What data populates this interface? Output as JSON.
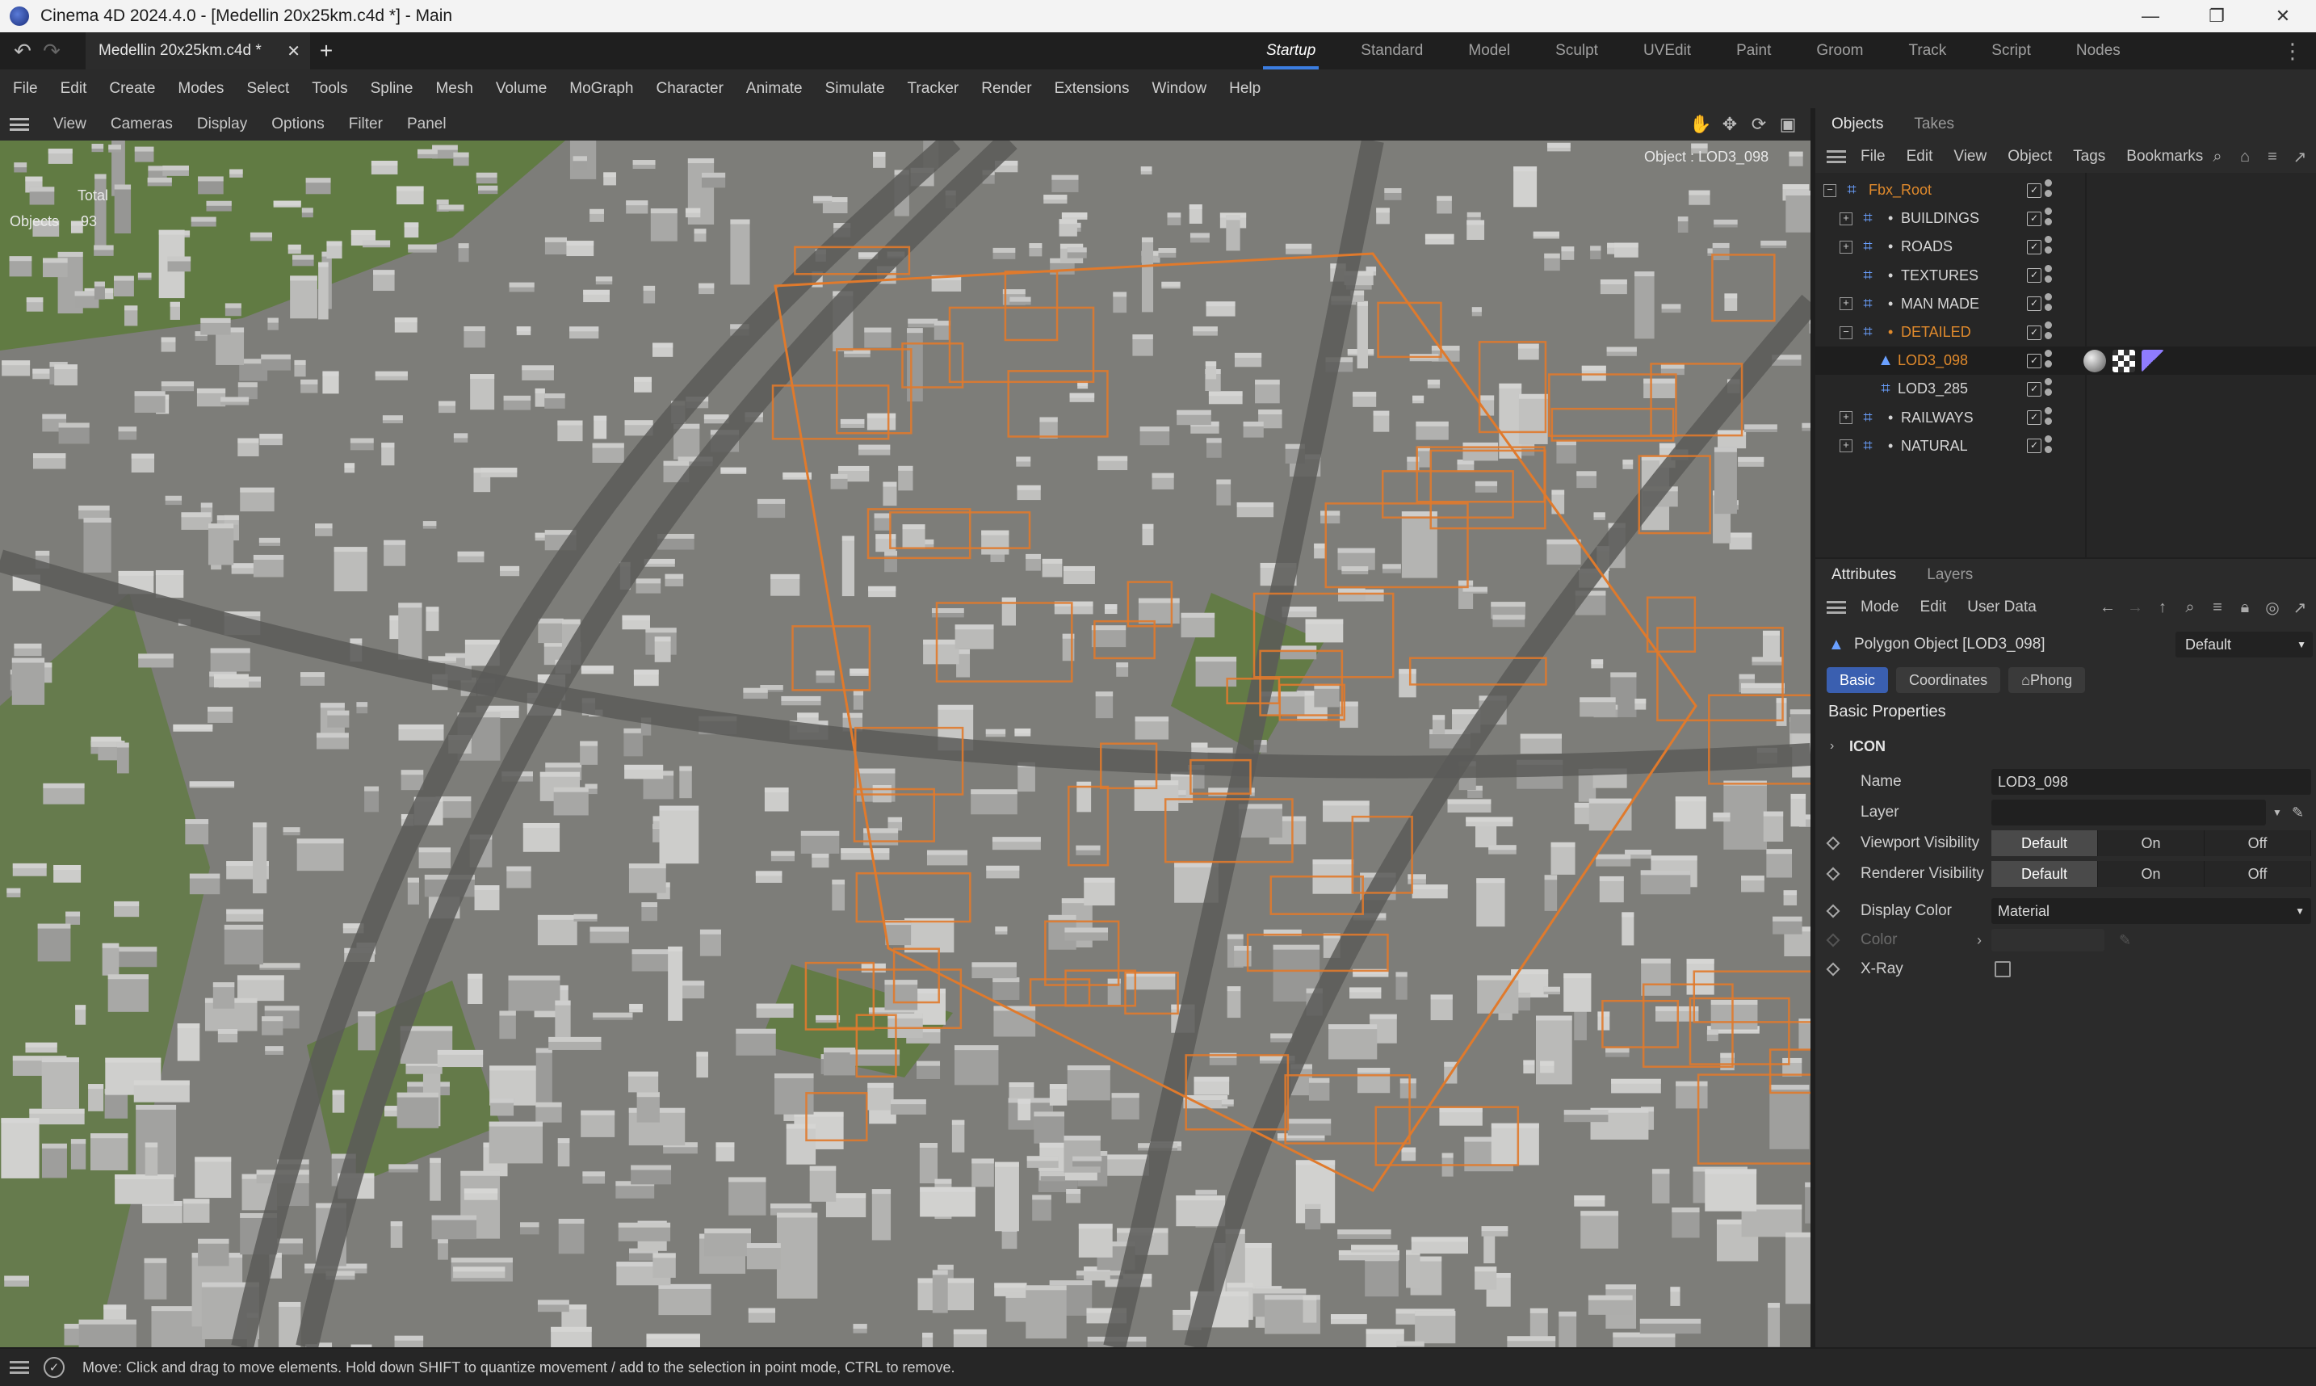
{
  "window": {
    "title": "Cinema 4D 2024.4.0 - [Medellin 20x25km.c4d *] - Main",
    "controls": {
      "minimize": "—",
      "restore": "❐",
      "close": "✕"
    }
  },
  "document_tab": {
    "label": "Medellin 20x25km.c4d *",
    "close": "✕",
    "new": "+"
  },
  "layouts": [
    "Startup",
    "Standard",
    "Model",
    "Sculpt",
    "UVEdit",
    "Paint",
    "Groom",
    "Track",
    "Script",
    "Nodes"
  ],
  "active_layout": "Startup",
  "main_menu": [
    "File",
    "Edit",
    "Create",
    "Modes",
    "Select",
    "Tools",
    "Spline",
    "Mesh",
    "Volume",
    "MoGraph",
    "Character",
    "Animate",
    "Simulate",
    "Tracker",
    "Render",
    "Extensions",
    "Window",
    "Help"
  ],
  "viewport": {
    "menu": [
      "View",
      "Cameras",
      "Display",
      "Options",
      "Filter",
      "Panel"
    ],
    "hud": {
      "total_label": "Total",
      "objects_label": "Objects",
      "objects_count": "93",
      "selection": "Object : LOD3_098"
    },
    "colors": {
      "ground": "#7d7d79",
      "grass": "#5c7a3a",
      "building": "#b9b9b7",
      "highlight": "#e07a2c",
      "road": "#5a5a58"
    }
  },
  "objects_panel": {
    "tabs": [
      "Objects",
      "Takes"
    ],
    "menu": [
      "File",
      "Edit",
      "View",
      "Object",
      "Tags",
      "Bookmarks"
    ],
    "tree": [
      {
        "label": "Fbx_Root",
        "depth": 0,
        "expander": "−",
        "orange": true,
        "bullet": false
      },
      {
        "label": "BUILDINGS",
        "depth": 1,
        "expander": "+",
        "orange": false,
        "bullet": true
      },
      {
        "label": "ROADS",
        "depth": 1,
        "expander": "+",
        "orange": false,
        "bullet": true
      },
      {
        "label": "TEXTURES",
        "depth": 1,
        "expander": "",
        "orange": false,
        "bullet": true
      },
      {
        "label": "MAN MADE",
        "depth": 1,
        "expander": "+",
        "orange": false,
        "bullet": true
      },
      {
        "label": "DETAILED",
        "depth": 1,
        "expander": "−",
        "orange": true,
        "bullet": true
      },
      {
        "label": "LOD3_098",
        "depth": 2,
        "expander": "",
        "orange": true,
        "bullet": false,
        "selected": true
      },
      {
        "label": "LOD3_285",
        "depth": 2,
        "expander": "",
        "orange": false,
        "bullet": false
      },
      {
        "label": "RAILWAYS",
        "depth": 1,
        "expander": "+",
        "orange": false,
        "bullet": true
      },
      {
        "label": "NATURAL",
        "depth": 1,
        "expander": "+",
        "orange": false,
        "bullet": true
      }
    ]
  },
  "attributes_panel": {
    "tabs": [
      "Attributes",
      "Layers"
    ],
    "menu": [
      "Mode",
      "Edit",
      "User Data"
    ],
    "object_title": "Polygon Object [LOD3_098]",
    "preset": "Default",
    "subtabs": [
      "Basic",
      "Coordinates",
      "Phong"
    ],
    "active_subtab": "Basic",
    "section_title": "Basic Properties",
    "group_label": "ICON",
    "fields": {
      "name_label": "Name",
      "name_value": "LOD3_098",
      "layer_label": "Layer",
      "layer_value": "",
      "viewport_visibility_label": "Viewport Visibility",
      "renderer_visibility_label": "Renderer Visibility",
      "visibility_options": [
        "Default",
        "On",
        "Off"
      ],
      "display_color_label": "Display Color",
      "display_color_value": "Material",
      "color_label": "Color",
      "xray_label": "X-Ray"
    }
  },
  "status_bar": {
    "message": "Move: Click and drag to move elements. Hold down SHIFT to quantize movement / add to the selection in point mode, CTRL to remove."
  }
}
